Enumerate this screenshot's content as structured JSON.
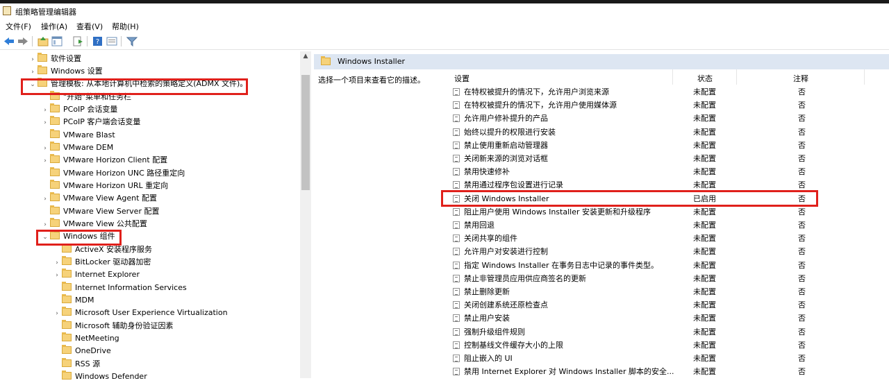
{
  "window": {
    "title": "组策略管理编辑器"
  },
  "menu": [
    {
      "label": "文件(F)"
    },
    {
      "label": "操作(A)"
    },
    {
      "label": "查看(V)"
    },
    {
      "label": "帮助(H)"
    }
  ],
  "toolbar_icons": [
    "back-arrow-icon",
    "forward-arrow-icon",
    "up-folder-icon",
    "show-hide-tree-icon",
    "export-list-icon",
    "help-icon",
    "properties-icon",
    "filter-icon"
  ],
  "tree": [
    {
      "label": "软件设置",
      "toggle": "›"
    },
    {
      "label": "Windows 设置",
      "toggle": "›"
    },
    {
      "label": "管理模板: 从本地计算机中检索的策略定义(ADMX 文件)。",
      "toggle": "⌄"
    },
    {
      "label": "\"开始\"菜单和任务栏",
      "toggle": ""
    },
    {
      "label": "PCoIP 会话变量",
      "toggle": "›"
    },
    {
      "label": "PCoIP 客户端会话变量",
      "toggle": "›"
    },
    {
      "label": "VMware Blast",
      "toggle": ""
    },
    {
      "label": "VMware DEM",
      "toggle": "›"
    },
    {
      "label": "VMware Horizon Client 配置",
      "toggle": "›"
    },
    {
      "label": "VMware Horizon UNC 路径重定向",
      "toggle": ""
    },
    {
      "label": "VMware Horizon URL 重定向",
      "toggle": ""
    },
    {
      "label": "VMware View Agent 配置",
      "toggle": "›"
    },
    {
      "label": "VMware View Server 配置",
      "toggle": ""
    },
    {
      "label": "VMware View 公共配置",
      "toggle": "›"
    },
    {
      "label": "Windows 组件",
      "toggle": "⌄"
    },
    {
      "label": "ActiveX 安装程序服务",
      "toggle": ""
    },
    {
      "label": "BitLocker 驱动器加密",
      "toggle": "›"
    },
    {
      "label": "Internet Explorer",
      "toggle": "›"
    },
    {
      "label": "Internet Information Services",
      "toggle": ""
    },
    {
      "label": "MDM",
      "toggle": ""
    },
    {
      "label": "Microsoft User Experience Virtualization",
      "toggle": "›"
    },
    {
      "label": "Microsoft 辅助身份验证因素",
      "toggle": ""
    },
    {
      "label": "NetMeeting",
      "toggle": ""
    },
    {
      "label": "OneDrive",
      "toggle": ""
    },
    {
      "label": "RSS 源",
      "toggle": ""
    },
    {
      "label": "Windows Defender",
      "toggle": ""
    }
  ],
  "right": {
    "header": "Windows Installer",
    "description": "选择一个项目来查看它的描述。",
    "columns": {
      "setting": "设置",
      "state": "状态",
      "note": "注释"
    },
    "rows": [
      {
        "name": "在特权被提升的情况下，允许用户浏览来源",
        "state": "未配置",
        "note": "否"
      },
      {
        "name": "在特权被提升的情况下，允许用户使用媒体源",
        "state": "未配置",
        "note": "否"
      },
      {
        "name": "允许用户修补提升的产品",
        "state": "未配置",
        "note": "否"
      },
      {
        "name": "始终以提升的权限进行安装",
        "state": "未配置",
        "note": "否"
      },
      {
        "name": "禁止使用重新启动管理器",
        "state": "未配置",
        "note": "否"
      },
      {
        "name": "关闭新来源的浏览对话框",
        "state": "未配置",
        "note": "否"
      },
      {
        "name": "禁用快速修补",
        "state": "未配置",
        "note": "否"
      },
      {
        "name": "禁用通过程序包设置进行记录",
        "state": "未配置",
        "note": "否"
      },
      {
        "name": "关闭 Windows Installer",
        "state": "已启用",
        "note": "否"
      },
      {
        "name": "阻止用户使用 Windows Installer 安装更新和升级程序",
        "state": "未配置",
        "note": "否"
      },
      {
        "name": "禁用回退",
        "state": "未配置",
        "note": "否"
      },
      {
        "name": "关闭共享的组件",
        "state": "未配置",
        "note": "否"
      },
      {
        "name": "允许用户对安装进行控制",
        "state": "未配置",
        "note": "否"
      },
      {
        "name": "指定 Windows Installer 在事务日志中记录的事件类型。",
        "state": "未配置",
        "note": "否"
      },
      {
        "name": "禁止非管理员应用供应商签名的更新",
        "state": "未配置",
        "note": "否"
      },
      {
        "name": "禁止删除更新",
        "state": "未配置",
        "note": "否"
      },
      {
        "name": "关闭创建系统还原检查点",
        "state": "未配置",
        "note": "否"
      },
      {
        "name": "禁止用户安装",
        "state": "未配置",
        "note": "否"
      },
      {
        "name": "强制升级组件规则",
        "state": "未配置",
        "note": "否"
      },
      {
        "name": "控制基线文件缓存大小的上限",
        "state": "未配置",
        "note": "否"
      },
      {
        "name": "阻止嵌入的 UI",
        "state": "未配置",
        "note": "否"
      },
      {
        "name": "禁用 Internet Explorer 对 Windows Installer 脚本的安全...",
        "state": "未配置",
        "note": "否"
      }
    ]
  },
  "colors": {
    "highlight": "#e0201b",
    "header_bg": "#dde6f2",
    "folder": "#f6d27a"
  }
}
